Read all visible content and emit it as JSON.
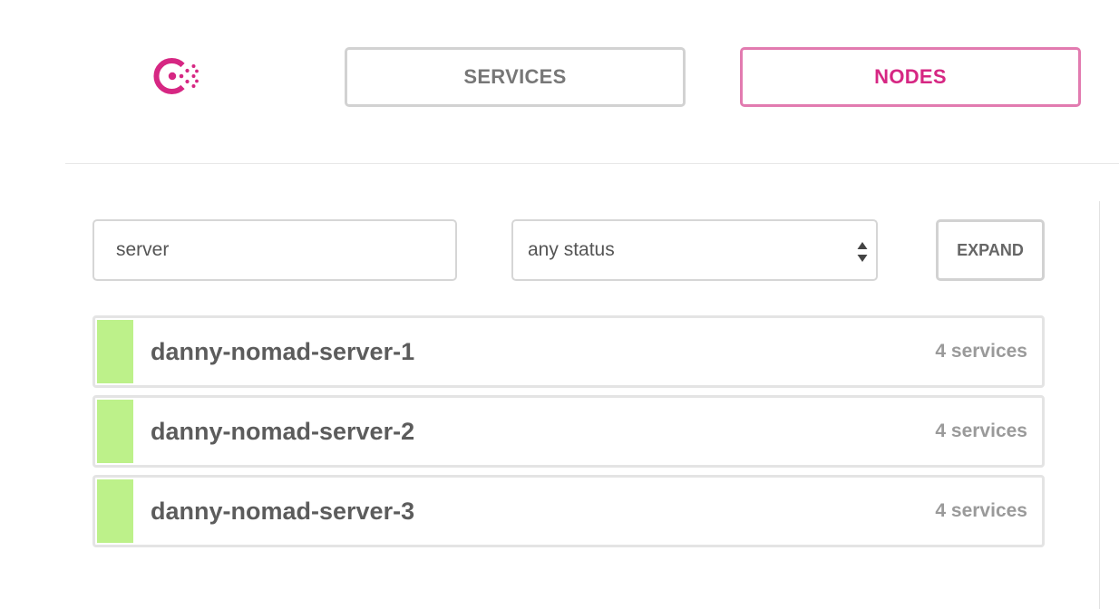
{
  "header": {
    "logo_icon": "consul-logo-icon",
    "brand_color": "#d62783",
    "nav": {
      "services_label": "SERVICES",
      "nodes_label": "NODES",
      "active": "nodes"
    }
  },
  "filters": {
    "search_value": "server",
    "status_value": "any status",
    "expand_label": "EXPAND"
  },
  "nodes": [
    {
      "name": "danny-nomad-server-1",
      "services": "4 services",
      "status_color": "#bdf18a"
    },
    {
      "name": "danny-nomad-server-2",
      "services": "4 services",
      "status_color": "#bdf18a"
    },
    {
      "name": "danny-nomad-server-3",
      "services": "4 services",
      "status_color": "#bdf18a"
    }
  ]
}
